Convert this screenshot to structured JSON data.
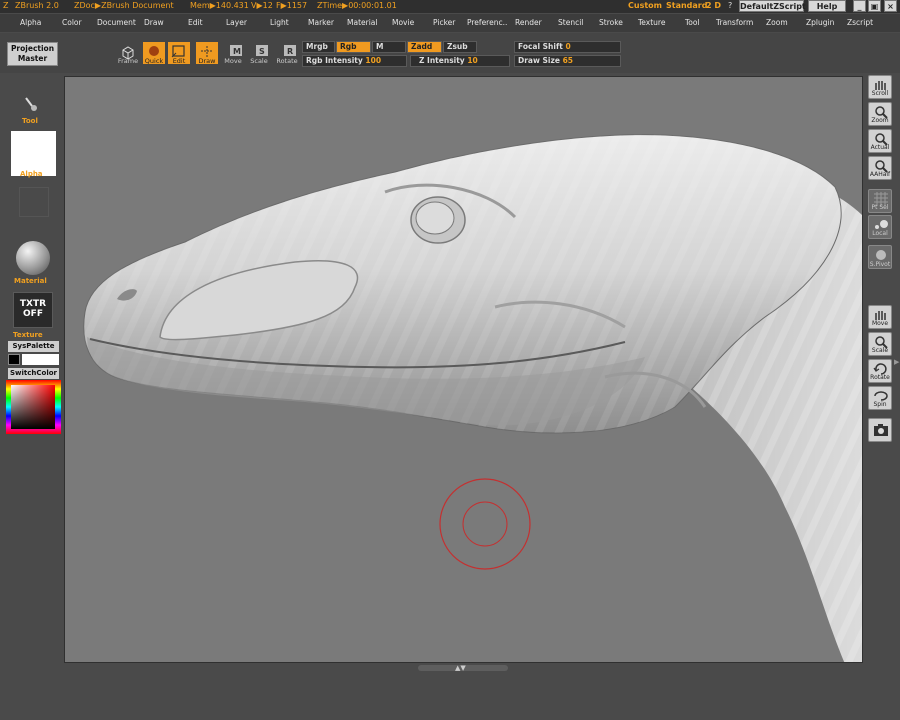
{
  "titlebar": {
    "app": "ZBrush 2.0",
    "document": "ZDoc▶ZBrush Document",
    "mem": "Mem▶140.431",
    "verts": "V▶12",
    "faces": "F▶1157",
    "ztime": "ZTime▶00:00:01.01",
    "layout_custom": "Custom",
    "layout_standard": "Standard",
    "layout_2d": "2 D",
    "help_q": "?",
    "default_zscript": "DefaultZScript",
    "help": "Help"
  },
  "menu": [
    "Alpha",
    "Color",
    "Document",
    "Draw",
    "Edit",
    "Layer",
    "Light",
    "Marker",
    "Material",
    "Movie",
    "Picker",
    "Preferenc..",
    "Render",
    "Stencil",
    "Stroke",
    "Texture",
    "Tool",
    "Transform",
    "Zoom",
    "Zplugin",
    "Zscript"
  ],
  "toolbar": {
    "projection_master": "Projection Master",
    "buttons": [
      {
        "label": "Frame",
        "active": false
      },
      {
        "label": "Quick",
        "active": true
      },
      {
        "label": "Edit",
        "active": true
      },
      {
        "label": "Draw",
        "active": true
      },
      {
        "label": "Move",
        "active": false
      },
      {
        "label": "Scale",
        "active": false
      },
      {
        "label": "Rotate",
        "active": false
      }
    ],
    "mrgb": "Mrgb",
    "rgb": "Rgb",
    "m": "M",
    "zadd": "Zadd",
    "zsub": "Zsub",
    "rgb_intensity_label": "Rgb Intensity",
    "rgb_intensity_value": "100",
    "z_intensity_label": "Z Intensity",
    "z_intensity_value": "10",
    "focal_shift_label": "Focal Shift",
    "focal_shift_value": "0",
    "draw_size_label": "Draw Size",
    "draw_size_value": "65"
  },
  "leftshelf": {
    "tool": "Tool",
    "alpha": "Alpha",
    "material": "Material",
    "texture_button": "TXTR OFF",
    "texture": "Texture",
    "syspalette": "SysPalette",
    "switchcolor": "SwitchColor",
    "main_color": "#000000",
    "secondary_color": "#ffffff"
  },
  "rightshelf": [
    "Scroll",
    "Zoom",
    "Actual",
    "AAHalf",
    "Pt Sel",
    "Local",
    "S.Pivot",
    "Move",
    "Scale",
    "Rotate",
    "Spin",
    ""
  ],
  "brush": {
    "outer_color": "#c43030",
    "inner_color": "#c43030"
  },
  "colors": {
    "accent": "#f09a20",
    "canvas_bg": "#7a7a7a"
  }
}
